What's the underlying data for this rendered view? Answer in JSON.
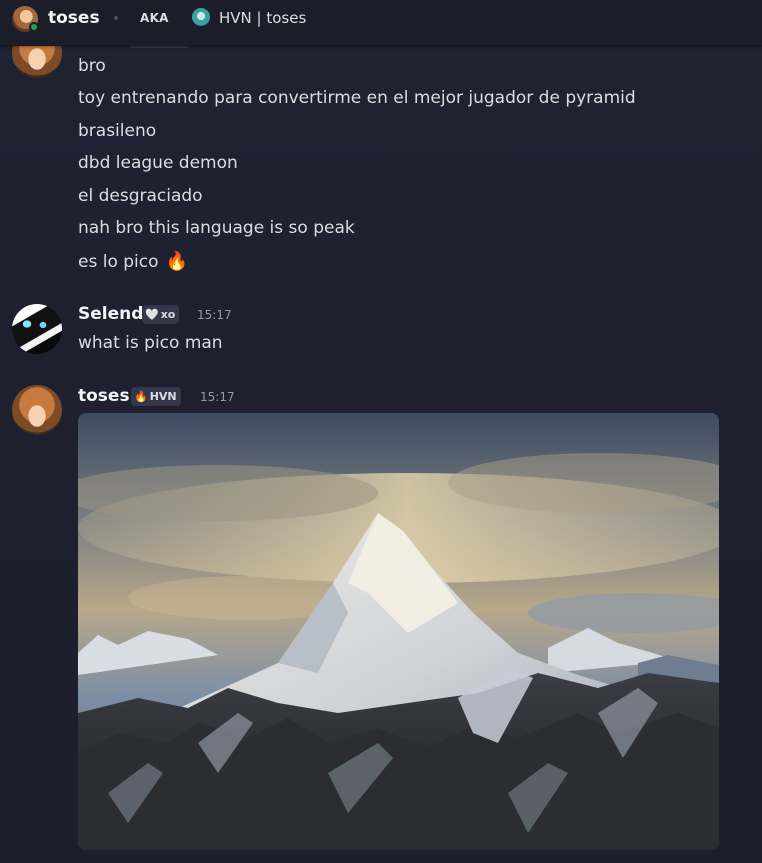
{
  "header": {
    "username": "toses",
    "aka_label": "AKA",
    "aka_name": "HVN | toses",
    "status_color": "#23a55a"
  },
  "messages": [
    {
      "author": "toses",
      "continued_lines": [
        "bro",
        "toy entrenando para convertirme en el mejor jugador de pyramid",
        "brasileno",
        "dbd league demon",
        "el desgraciado",
        "nah bro this language is so peak",
        "es lo pico"
      ],
      "last_line_emoji": "🔥"
    },
    {
      "author": "Selend",
      "tag": {
        "icon": "🤍",
        "text": "xo"
      },
      "time": "15:17",
      "lines": [
        "what is pico man"
      ]
    },
    {
      "author": "toses",
      "tag": {
        "icon": "🔥",
        "text": "HVN"
      },
      "time": "15:17",
      "attachment": {
        "kind": "image",
        "subject": "mountain-peak-photo"
      }
    }
  ]
}
